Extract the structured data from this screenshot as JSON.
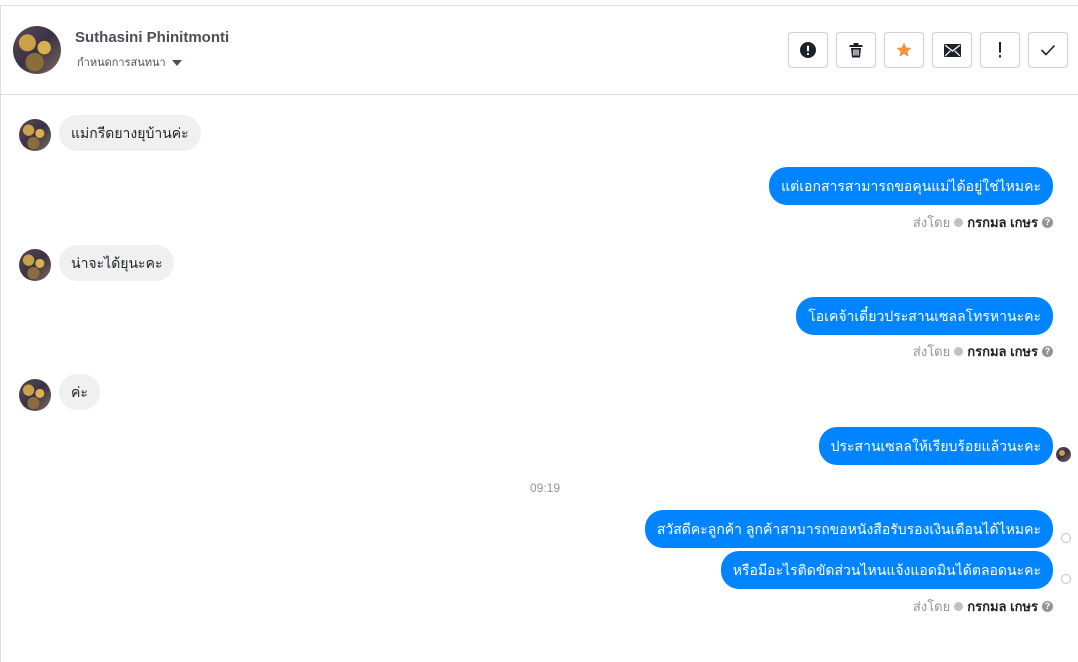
{
  "header": {
    "contact_name": "Suthasini Phinitmonti",
    "assign_label": "กำหนดการสนทนา",
    "toolbar": [
      {
        "name": "report-icon-button",
        "icon": "exclamation-circle-icon"
      },
      {
        "name": "delete-button",
        "icon": "trash-icon"
      },
      {
        "name": "star-button",
        "icon": "star-icon",
        "color": "#f7923b"
      },
      {
        "name": "mark-unread-button",
        "icon": "envelope-icon"
      },
      {
        "name": "flag-button",
        "icon": "exclamation-icon"
      },
      {
        "name": "mark-done-button",
        "icon": "check-icon"
      }
    ]
  },
  "messages": {
    "in1": "แม่กรีดยางยุบ้านค่ะ",
    "out1": "แต่เอกสารสามารถขอคุนแม่ได้อยู่ใช่ไหมคะ",
    "in2": "น่าจะได้ยุนะคะ",
    "out2": "โอเคจ้าเดี๋ยวประสานเซลลโทรหานะคะ",
    "in3": "ค่ะ",
    "out3": "ประสานเซลลให้เรียบร้อยแล้วนะคะ",
    "time": "09:19",
    "out4": "สวัสดีคะลูกค้า ลูกค้าสามารถขอหนังสือรับรองเงินเดือนได้ไหมคะ",
    "out5": "หรือมีอะไรติดขัดส่วนไหนแจ้งแอดมินได้ตลอดนะคะ"
  },
  "sent_by": {
    "label": "ส่งโดย",
    "agent": "กรกมล เกษร"
  },
  "colors": {
    "outgoing_bubble": "#0084ff",
    "incoming_bubble": "#f1f0f0"
  }
}
